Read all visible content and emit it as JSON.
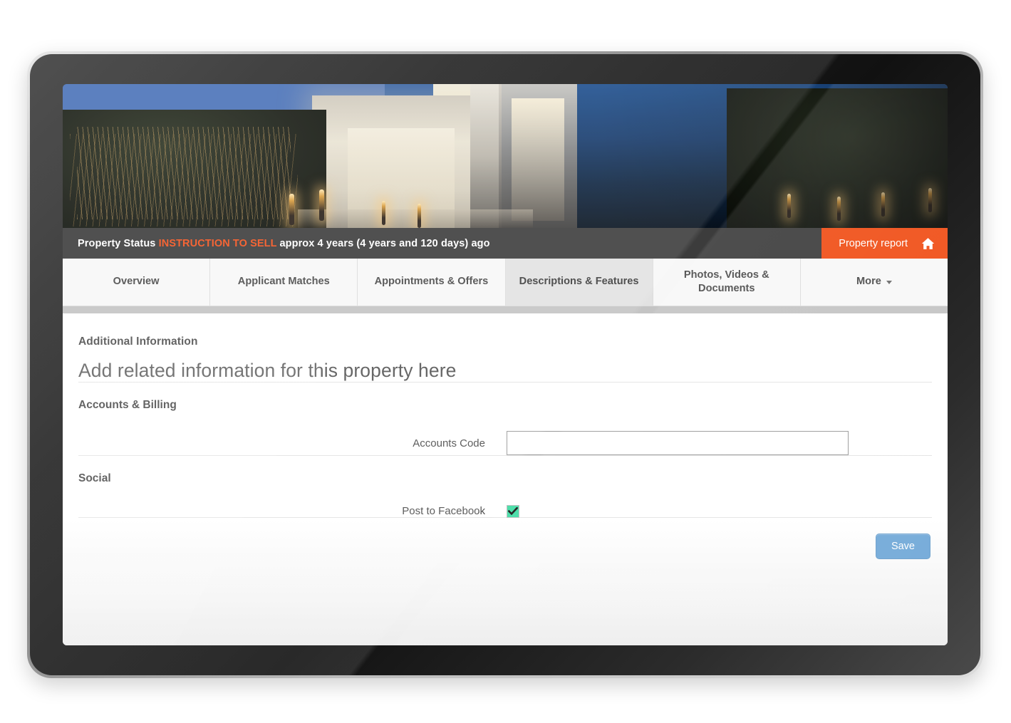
{
  "status": {
    "label": "Property Status",
    "highlight": "INSTRUCTION TO SELL",
    "detail": "approx 4 years (4 years and 120 days) ago"
  },
  "property_report": {
    "label": "Property report",
    "icon": "home-icon"
  },
  "tabs": [
    {
      "label": "Overview",
      "active": false
    },
    {
      "label": "Applicant Matches",
      "active": false
    },
    {
      "label": "Appointments & Offers",
      "active": false
    },
    {
      "label": "Descriptions & Features",
      "active": true
    },
    {
      "label": "Photos, Videos & Documents",
      "active": false
    },
    {
      "label": "More",
      "active": false,
      "has_caret": true
    }
  ],
  "main": {
    "section_title": "Additional Information",
    "subtitle": "Add related information for this property here",
    "accounts": {
      "group_title": "Accounts & Billing",
      "accounts_code_label": "Accounts Code",
      "accounts_code_value": "",
      "accounts_code_placeholder": ""
    },
    "social": {
      "group_title": "Social",
      "post_to_facebook_label": "Post to Facebook",
      "post_to_facebook_checked": true
    },
    "save_label": "Save"
  },
  "colors": {
    "accent_orange": "#f04e16",
    "status_highlight": "#f5541e",
    "save_blue": "#72a9d8",
    "checkbox_green": "#3ddba2",
    "tab_active_bg": "#e2e2e2",
    "banner_blue": "#4a72b8"
  }
}
